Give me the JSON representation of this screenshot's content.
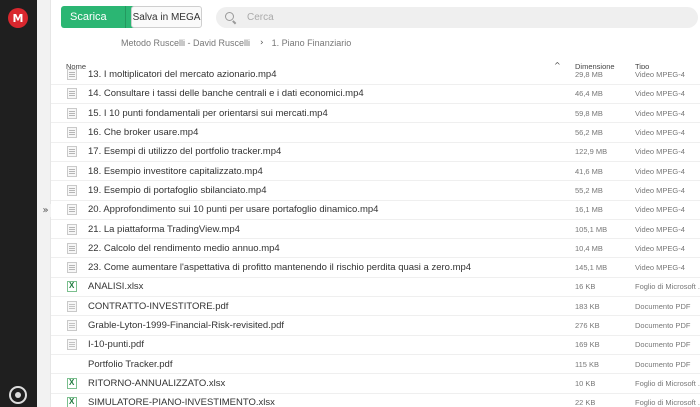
{
  "sidebar": {
    "logo_letter": "M"
  },
  "toolbar": {
    "download_label": "Scarica",
    "download_arrow": "▾",
    "save_label": "Salva in MEGA"
  },
  "search": {
    "placeholder": "Cerca"
  },
  "breadcrumb": {
    "items": [
      "Metodo Ruscelli - David Ruscelli",
      "1. Piano Finanziario"
    ],
    "separator": "›"
  },
  "gutter": {
    "expand_glyph": "»"
  },
  "table": {
    "columns": {
      "name": "Nome",
      "size": "Dimensione",
      "type": "Tipo",
      "sort_glyph": "^"
    },
    "rows": [
      {
        "icon": "video",
        "name": "13. I moltiplicatori del mercato azionario.mp4",
        "size": "29,8 MB",
        "type": "Video MPEG-4"
      },
      {
        "icon": "video",
        "name": "14. Consultare i tassi delle banche centrali e i dati economici.mp4",
        "size": "46,4 MB",
        "type": "Video MPEG-4"
      },
      {
        "icon": "video",
        "name": "15. I 10 punti fondamentali per orientarsi sui mercati.mp4",
        "size": "59,8 MB",
        "type": "Video MPEG-4"
      },
      {
        "icon": "video",
        "name": "16. Che broker usare.mp4",
        "size": "56,2 MB",
        "type": "Video MPEG-4"
      },
      {
        "icon": "video",
        "name": "17. Esempi di utilizzo del portfolio tracker.mp4",
        "size": "122,9 MB",
        "type": "Video MPEG-4"
      },
      {
        "icon": "video",
        "name": "18. Esempio investitore capitalizzato.mp4",
        "size": "41,6 MB",
        "type": "Video MPEG-4"
      },
      {
        "icon": "video",
        "name": "19. Esempio di portafoglio sbilanciato.mp4",
        "size": "55,2 MB",
        "type": "Video MPEG-4"
      },
      {
        "icon": "video",
        "name": "20. Approfondimento sui 10 punti per usare portafoglio dinamico.mp4",
        "size": "16,1 MB",
        "type": "Video MPEG-4"
      },
      {
        "icon": "video",
        "name": "21. La piattaforma TradingView.mp4",
        "size": "105,1 MB",
        "type": "Video MPEG-4"
      },
      {
        "icon": "video",
        "name": "22. Calcolo del rendimento medio annuo.mp4",
        "size": "10,4 MB",
        "type": "Video MPEG-4"
      },
      {
        "icon": "video",
        "name": "23. Come aumentare l'aspettativa di profitto mantenendo il rischio perdita quasi a zero.mp4",
        "size": "145,1 MB",
        "type": "Video MPEG-4"
      },
      {
        "icon": "xlsx",
        "name": "ANALISI.xlsx",
        "size": "16 KB",
        "type": "Foglio di Microsoft ..."
      },
      {
        "icon": "pdf",
        "name": "CONTRATTO-INVESTITORE.pdf",
        "size": "183 KB",
        "type": "Documento PDF"
      },
      {
        "icon": "pdf",
        "name": "Grable-Lyton-1999-Financial-Risk-revisited.pdf",
        "size": "276 KB",
        "type": "Documento PDF"
      },
      {
        "icon": "pdf",
        "name": "I-10-punti.pdf",
        "size": "169 KB",
        "type": "Documento PDF"
      },
      {
        "icon": "none",
        "name": "Portfolio Tracker.pdf",
        "size": "115 KB",
        "type": "Documento PDF"
      },
      {
        "icon": "xlsx",
        "name": "RITORNO-ANNUALIZZATO.xlsx",
        "size": "10 KB",
        "type": "Foglio di Microsoft ..."
      },
      {
        "icon": "xlsx",
        "name": "SIMULATORE-PIANO-INVESTIMENTO.xlsx",
        "size": "22 KB",
        "type": "Foglio di Microsoft ..."
      }
    ]
  }
}
